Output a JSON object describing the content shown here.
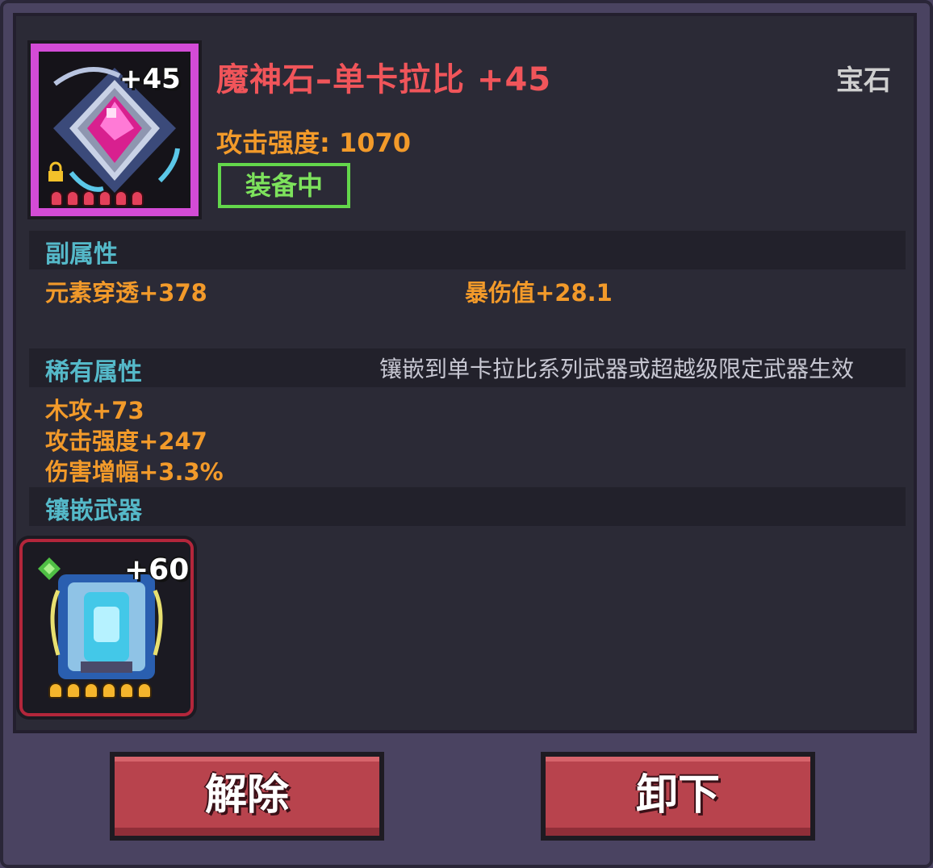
{
  "item": {
    "name": "魔神石–单卡拉比 +45",
    "category": "宝石",
    "level_badge": "+45",
    "attack_label": "攻击强度: 1070",
    "status": "装备中",
    "stars": 6,
    "icon": "magenta-gem-icon"
  },
  "sections": {
    "sub_attr": {
      "title": "副属性",
      "stats": [
        "元素穿透+378",
        "暴伤值+28.1"
      ]
    },
    "rare_attr": {
      "title": "稀有属性",
      "note": "镶嵌到单卡拉比系列武器或超越级限定武器生效",
      "stats": [
        "木攻+73",
        "攻击强度+247",
        "伤害增幅+3.3%"
      ]
    },
    "inlay": {
      "title": "镶嵌武器",
      "weapon": {
        "level_badge": "+60",
        "stars": 6,
        "icon": "blue-armor-weapon-icon"
      }
    }
  },
  "buttons": {
    "remove": "解除",
    "unequip": "卸下"
  },
  "colors": {
    "title": "#f0555a",
    "stat": "#f29a2a",
    "section": "#55b9c9",
    "equipped": "#7de25c",
    "button": "#b8434d"
  }
}
